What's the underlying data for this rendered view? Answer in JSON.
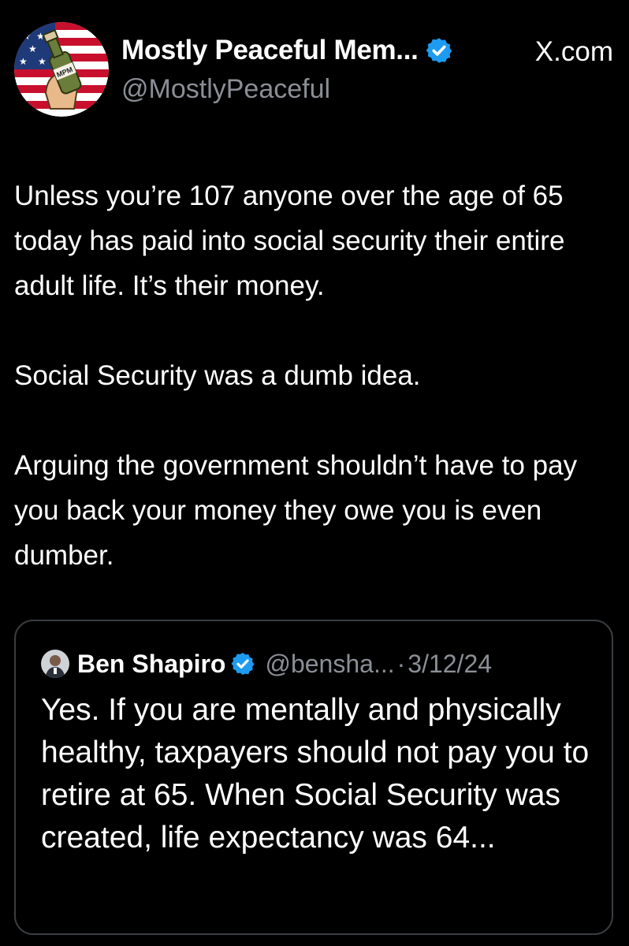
{
  "author": {
    "display_name": "Mostly Peaceful Mem...",
    "handle": "@MostlyPeaceful",
    "avatar_icon": "flag-molotov-avatar",
    "avatar_text": "MPM"
  },
  "source_label": "X.com",
  "tweet": {
    "paragraphs": [
      "Unless you’re 107 anyone over the age of 65 today has paid into social security their entire adult life. It’s their money.",
      "Social Security was a dumb idea.",
      "Arguing the government shouldn’t have to pay you back your money they owe you is even dumber."
    ]
  },
  "quoted_tweet": {
    "display_name": "Ben Shapiro",
    "handle": "@bensha...",
    "separator": "·",
    "date": "3/12/24",
    "text": "Yes. If you are mentally and physically healthy, taxpayers should not pay you to retire at 65. When Social Security was created, life expectancy was 64..."
  },
  "colors": {
    "background": "#000000",
    "text_primary": "#ffffff",
    "text_secondary": "#8b8f95",
    "verified_blue": "#1d9bf0",
    "card_border": "#3a3d41"
  }
}
